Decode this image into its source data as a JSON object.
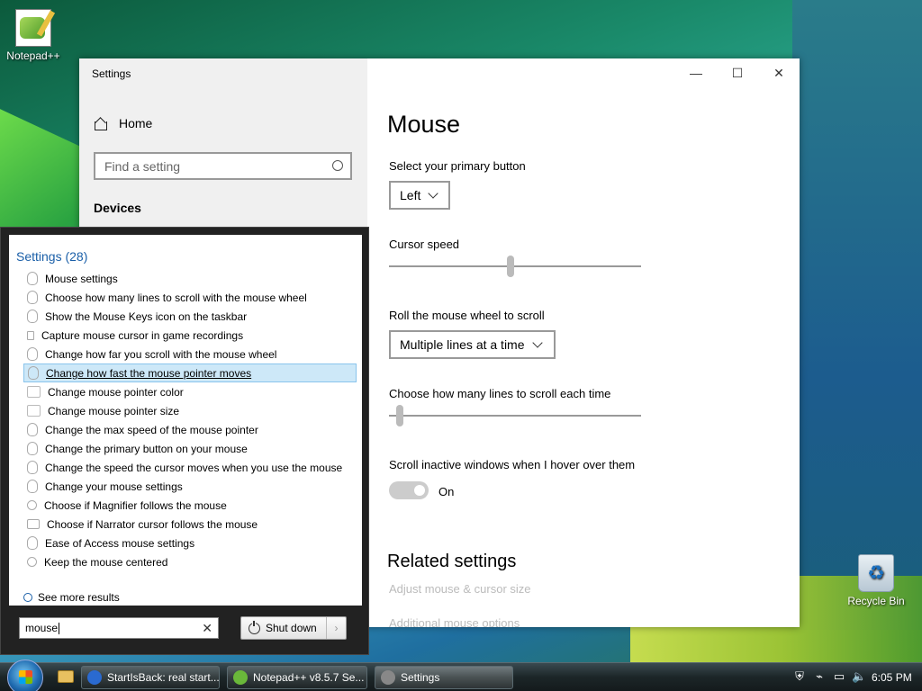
{
  "desktop": {
    "notepad_label": "Notepad++",
    "recycle_label": "Recycle Bin"
  },
  "settings_window": {
    "title": "Settings",
    "controls": {
      "minimize": "—",
      "maximize": "☐",
      "close": "✕"
    },
    "sidebar": {
      "home": "Home",
      "find_placeholder": "Find a setting",
      "section": "Devices"
    },
    "page_title": "Mouse",
    "primary_button": {
      "label": "Select your primary button",
      "value": "Left"
    },
    "cursor_speed": {
      "label": "Cursor speed",
      "value_fraction": 0.48
    },
    "roll_wheel": {
      "label": "Roll the mouse wheel to scroll",
      "value": "Multiple lines at a time"
    },
    "lines_to_scroll": {
      "label": "Choose how many lines to scroll each time",
      "value_fraction": 0.03
    },
    "inactive_scroll": {
      "label": "Scroll inactive windows when I hover over them",
      "state": "On"
    },
    "related": {
      "title": "Related settings",
      "links": [
        "Adjust mouse & cursor size",
        "Additional mouse options"
      ]
    }
  },
  "start_menu": {
    "group_title": "Settings (28)",
    "results": [
      {
        "text": "Mouse settings",
        "icon": "mouse-icon"
      },
      {
        "text": "Choose how many lines to scroll with the mouse wheel",
        "icon": "mouse-icon"
      },
      {
        "text": "Show the Mouse Keys icon on the taskbar",
        "icon": "mouse-icon"
      },
      {
        "text": "Capture mouse cursor in game recordings",
        "icon": "camera-icon"
      },
      {
        "text": "Change how far you scroll with the mouse wheel",
        "icon": "mouse-icon"
      },
      {
        "text": "Change how fast the mouse pointer moves",
        "icon": "mouse-icon",
        "selected": true
      },
      {
        "text": "Change mouse pointer color",
        "icon": "hand-pointer-icon"
      },
      {
        "text": "Change mouse pointer size",
        "icon": "hand-pointer-icon"
      },
      {
        "text": "Change the max speed of the mouse pointer",
        "icon": "mouse-icon"
      },
      {
        "text": "Change the primary button on your mouse",
        "icon": "mouse-icon"
      },
      {
        "text": "Change the speed the cursor moves when you use the mouse",
        "icon": "mouse-icon"
      },
      {
        "text": "Change your mouse settings",
        "icon": "mouse-icon"
      },
      {
        "text": "Choose if Magnifier follows the mouse",
        "icon": "magnifier-icon"
      },
      {
        "text": "Choose if Narrator cursor follows the mouse",
        "icon": "narrator-icon"
      },
      {
        "text": "Ease of Access mouse settings",
        "icon": "mouse-icon"
      },
      {
        "text": "Keep the mouse centered",
        "icon": "magnifier-icon"
      }
    ],
    "see_more": "See more results",
    "search_value": "mouse",
    "clear_glyph": "✕",
    "shutdown_label": "Shut down",
    "shutdown_arrow": "›"
  },
  "taskbar": {
    "buttons": [
      {
        "label": "StartIsBack: real start...",
        "color": "#2a6ad0"
      },
      {
        "label": "Notepad++ v8.5.7 Se...",
        "color": "#6ab83a"
      },
      {
        "label": "Settings",
        "color": "#888888"
      }
    ],
    "clock": "6:05 PM"
  }
}
